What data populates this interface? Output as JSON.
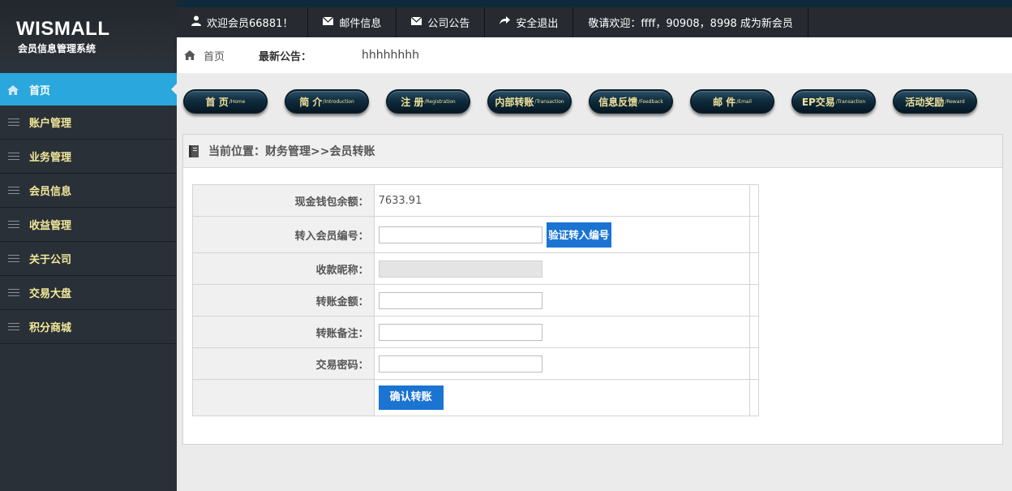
{
  "sidebar": {
    "logo_title": "WISMALL",
    "logo_subtitle": "会员信息管理系统",
    "items": [
      {
        "label": "首页",
        "icon": "home-icon",
        "active": true
      },
      {
        "label": "账户管理",
        "icon": "menu-lines-icon"
      },
      {
        "label": "业务管理",
        "icon": "menu-lines-icon"
      },
      {
        "label": "会员信息",
        "icon": "menu-lines-icon"
      },
      {
        "label": "收益管理",
        "icon": "menu-lines-icon"
      },
      {
        "label": "关于公司",
        "icon": "menu-lines-icon"
      },
      {
        "label": "交易大盘",
        "icon": "menu-lines-icon"
      },
      {
        "label": "积分商城",
        "icon": "menu-lines-icon"
      }
    ]
  },
  "topbar": {
    "welcome": "欢迎会员66881！",
    "mail": "邮件信息",
    "notice": "公司公告",
    "logout": "安全退出",
    "new_members": "敬请欢迎：ffff，90908，8998 成为新会员"
  },
  "crumb": {
    "home": "首页",
    "notice_label": "最新公告：",
    "notice_text": "hhhhhhhh"
  },
  "nav_buttons": [
    {
      "label": "首 页",
      "sub": "/Home"
    },
    {
      "label": "简 介",
      "sub": "/Introduction"
    },
    {
      "label": "注 册",
      "sub": "/Registration"
    },
    {
      "label": "内部转账",
      "sub": "/Transaction"
    },
    {
      "label": "信息反馈",
      "sub": "/Feedback"
    },
    {
      "label": "邮 件",
      "sub": "/Email"
    },
    {
      "label": "EP交易",
      "sub": "/Transaction"
    },
    {
      "label": "活动奖励",
      "sub": "/Reward"
    }
  ],
  "panel": {
    "title": "当前位置：财务管理>>会员转账"
  },
  "form": {
    "balance_label": "现金钱包余额：",
    "balance_value": "7633.91",
    "target_label": "转入会员编号：",
    "target_value": "",
    "verify_button": "验证转入编号",
    "nickname_label": "收款昵称：",
    "nickname_value": "",
    "amount_label": "转账金额：",
    "amount_value": "",
    "remark_label": "转账备注：",
    "remark_value": "",
    "password_label": "交易密码：",
    "password_value": "",
    "submit_button": "确认转账"
  },
  "colors": {
    "sidebar_bg": "#2a3037",
    "active_item": "#2aa7dc",
    "menu_text": "#f2e89a",
    "topbar_bg": "#272b31",
    "primary_button": "#1b73d2"
  }
}
